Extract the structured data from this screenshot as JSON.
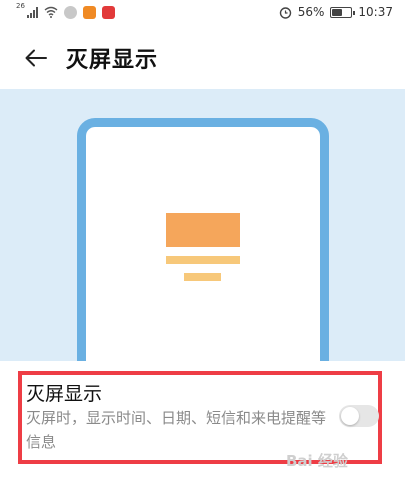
{
  "status_bar": {
    "network_tag": "26",
    "battery_percent": "56%",
    "battery_level": 0.56,
    "time": "10:37",
    "icons": [
      "signal-icon",
      "wifi-icon",
      "notification-icon",
      "video-app-icon",
      "weibo-icon",
      "alarm-icon",
      "battery-icon"
    ]
  },
  "title_bar": {
    "back_icon": "arrow-left-icon",
    "title": "灭屏显示"
  },
  "colors": {
    "preview_bg": "#dcecf8",
    "phone_frame": "#6ab0e2",
    "clock_block": "#f5a65b",
    "clock_lines": "#f7c87a",
    "highlight": "#ee3d45"
  },
  "setting": {
    "title": "灭屏显示",
    "description": "灭屏时，显示时间、日期、短信和来电提醒等信息",
    "toggle_on": false
  },
  "watermark": {
    "text": "Bai 经验"
  }
}
